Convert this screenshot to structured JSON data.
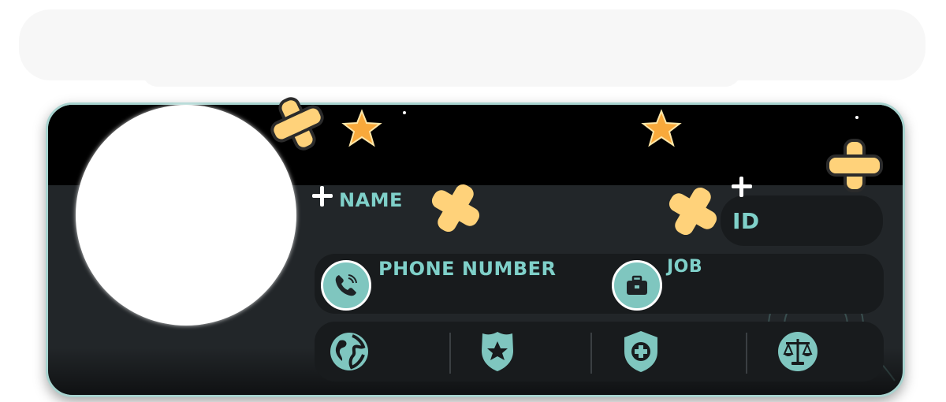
{
  "fields": {
    "name_label": "Name",
    "id_label": "ID",
    "phone_label": "Phone Number",
    "job_label": "Job"
  },
  "icons": {
    "phone": "phone-icon",
    "job": "briefcase-icon",
    "globe": "globe-icon",
    "police": "police-badge-icon",
    "medical": "medical-shield-icon",
    "law": "scales-of-justice-icon"
  },
  "colors": {
    "accent": "#7fd0c9",
    "card_background": "#222629",
    "card_header": "#000000",
    "panel": "#181b1d",
    "decoration_yellow": "#ffd27a",
    "decoration_orange": "#f39a2e"
  }
}
